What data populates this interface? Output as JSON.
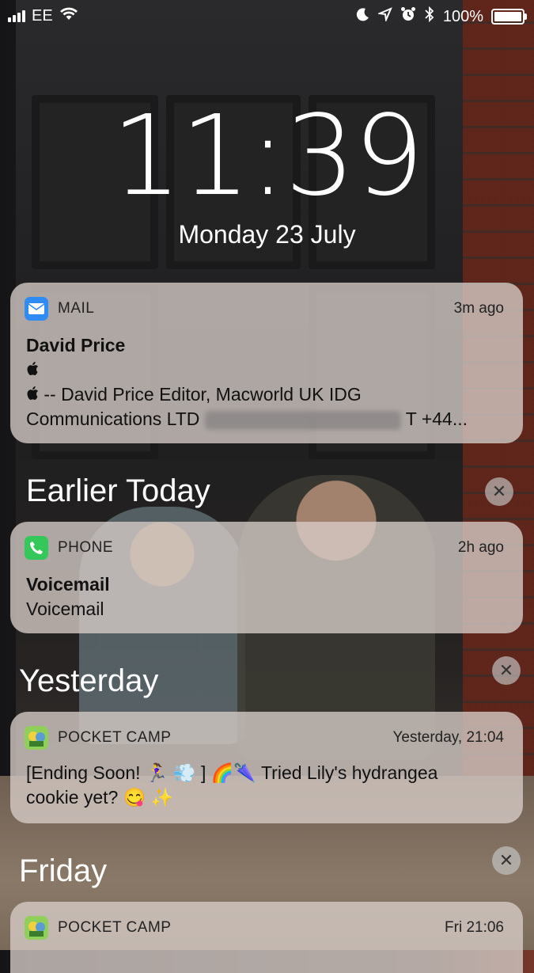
{
  "status": {
    "carrier": "EE",
    "battery": "100%",
    "icons": [
      "signal-bars-icon",
      "wifi-icon",
      "moon-icon",
      "location-arrow-icon",
      "alarm-icon",
      "bluetooth-icon",
      "battery-icon"
    ]
  },
  "lock": {
    "time": "11:39",
    "date": "Monday 23 July"
  },
  "notifications": [
    {
      "app": "MAIL",
      "ago": "3m ago",
      "title": "David Price",
      "line1": "",
      "line2": "-- David Price Editor, Macworld UK IDG",
      "line3a": "Communications LTD",
      "line3b": "T +44...",
      "icon": "mail-icon"
    },
    {
      "app": "PHONE",
      "ago": "2h ago",
      "title": "Voicemail",
      "line1": "Voicemail",
      "icon": "phone-icon"
    },
    {
      "app": "POCKET CAMP",
      "ago": "Yesterday, 21:04",
      "line1": "[Ending Soon! 🏃‍♀️ 💨 ] 🌈🌂 Tried Lily's hydrangea",
      "line2": "cookie yet? 😋 ✨",
      "icon": "pocket-camp-icon"
    },
    {
      "app": "POCKET CAMP",
      "ago": "Fri 21:06",
      "icon": "pocket-camp-icon"
    }
  ],
  "sections": {
    "earlier": "Earlier Today",
    "yesterday": "Yesterday",
    "friday": "Friday",
    "close": "✕"
  },
  "colors": {
    "mail": "#2f8cf5",
    "phone": "#34c759",
    "camp": "#8fcf5a"
  }
}
